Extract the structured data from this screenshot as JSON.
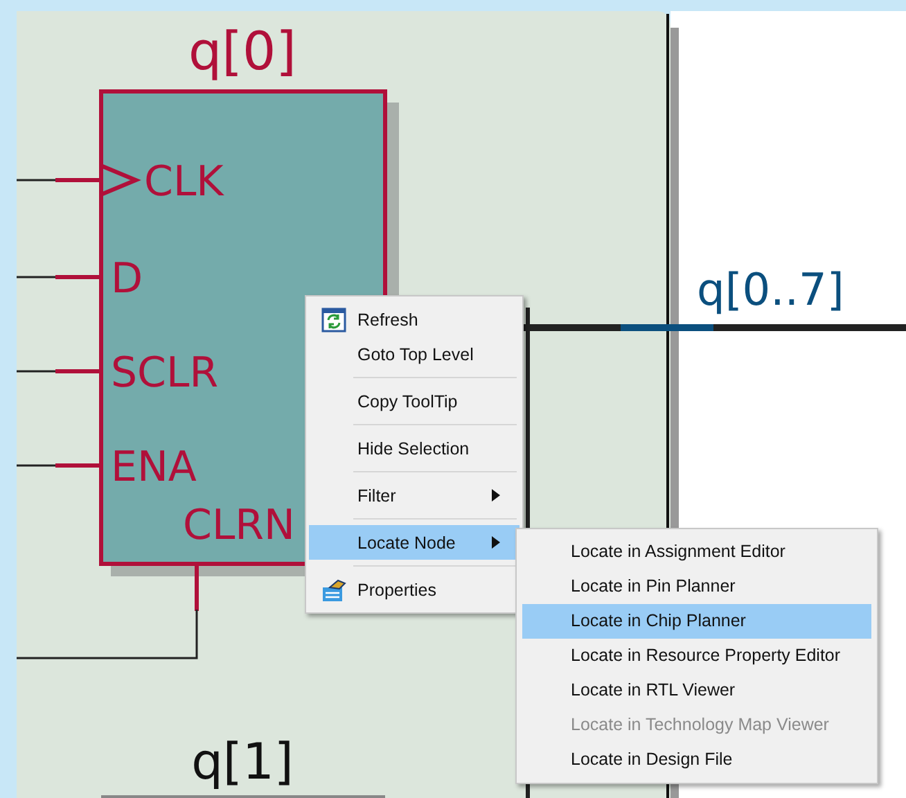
{
  "schematic": {
    "node_title": "q[0]",
    "pins": [
      {
        "label": "CLK",
        "kind": "clock"
      },
      {
        "label": "D",
        "kind": "input"
      },
      {
        "label": "SCLR",
        "kind": "input"
      },
      {
        "label": "ENA",
        "kind": "input"
      }
    ],
    "clear_pin": "CLRN",
    "bus_label": "q[0..7]",
    "next_node_title": "q[1]"
  },
  "context_menu": {
    "items": [
      {
        "kind": "refresh",
        "label": "Refresh",
        "selected": false,
        "submenu": false
      },
      {
        "kind": "item",
        "label": "Goto Top Level",
        "selected": false,
        "submenu": false
      },
      {
        "kind": "separator"
      },
      {
        "kind": "item",
        "label": "Copy ToolTip",
        "selected": false,
        "submenu": false
      },
      {
        "kind": "separator"
      },
      {
        "kind": "item",
        "label": "Hide Selection",
        "selected": false,
        "submenu": false
      },
      {
        "kind": "separator"
      },
      {
        "kind": "item",
        "label": "Filter",
        "selected": false,
        "submenu": true
      },
      {
        "kind": "separator"
      },
      {
        "kind": "item",
        "label": "Locate Node",
        "selected": true,
        "submenu": true
      },
      {
        "kind": "separator"
      },
      {
        "kind": "properties",
        "label": "Properties",
        "selected": false,
        "submenu": false
      }
    ]
  },
  "submenu": {
    "items": [
      {
        "label": "Locate in Assignment Editor",
        "selected": false,
        "disabled": false
      },
      {
        "label": "Locate in Pin Planner",
        "selected": false,
        "disabled": false
      },
      {
        "label": "Locate in Chip Planner",
        "selected": true,
        "disabled": false
      },
      {
        "label": "Locate in Resource Property Editor",
        "selected": false,
        "disabled": false
      },
      {
        "label": "Locate in RTL Viewer",
        "selected": false,
        "disabled": false
      },
      {
        "label": "Locate in Technology Map Viewer",
        "selected": false,
        "disabled": true
      },
      {
        "label": "Locate in Design File",
        "selected": false,
        "disabled": false
      }
    ]
  }
}
